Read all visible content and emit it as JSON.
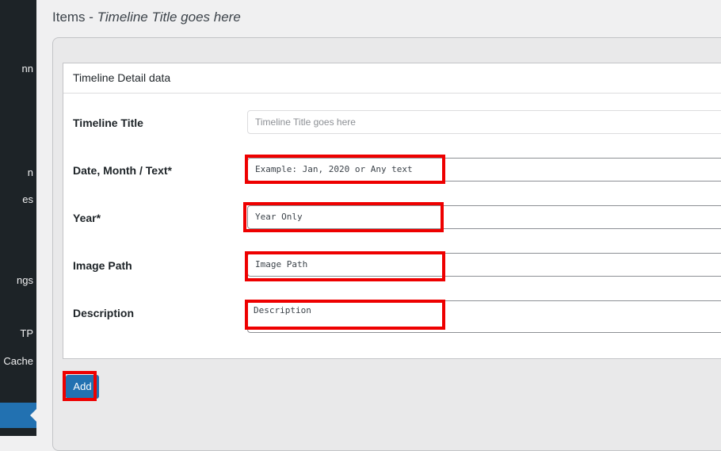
{
  "sidebar": {
    "items": [
      {
        "label": "nn"
      },
      {
        "label": "n"
      },
      {
        "label": "es"
      },
      {
        "label": "ngs"
      },
      {
        "label": "TP"
      },
      {
        "label": "Cache"
      }
    ]
  },
  "header": {
    "title_prefix": "Items - ",
    "title_italic": "Timeline Title goes here"
  },
  "card": {
    "title": "Timeline Detail data"
  },
  "form": {
    "timeline_title": {
      "label": "Timeline Title",
      "placeholder": "Timeline Title goes here"
    },
    "date_month_text": {
      "label": "Date, Month / Text*",
      "placeholder": "Example: Jan, 2020 or Any text"
    },
    "year": {
      "label": "Year*",
      "placeholder": "Year Only"
    },
    "image_path": {
      "label": "Image Path",
      "placeholder": "Image Path"
    },
    "description": {
      "label": "Description",
      "placeholder": "Description"
    }
  },
  "actions": {
    "add_label": "Add"
  },
  "colors": {
    "accent": "#2271b1",
    "highlight": "#ee0000",
    "sidebar_bg": "#1d2327"
  }
}
